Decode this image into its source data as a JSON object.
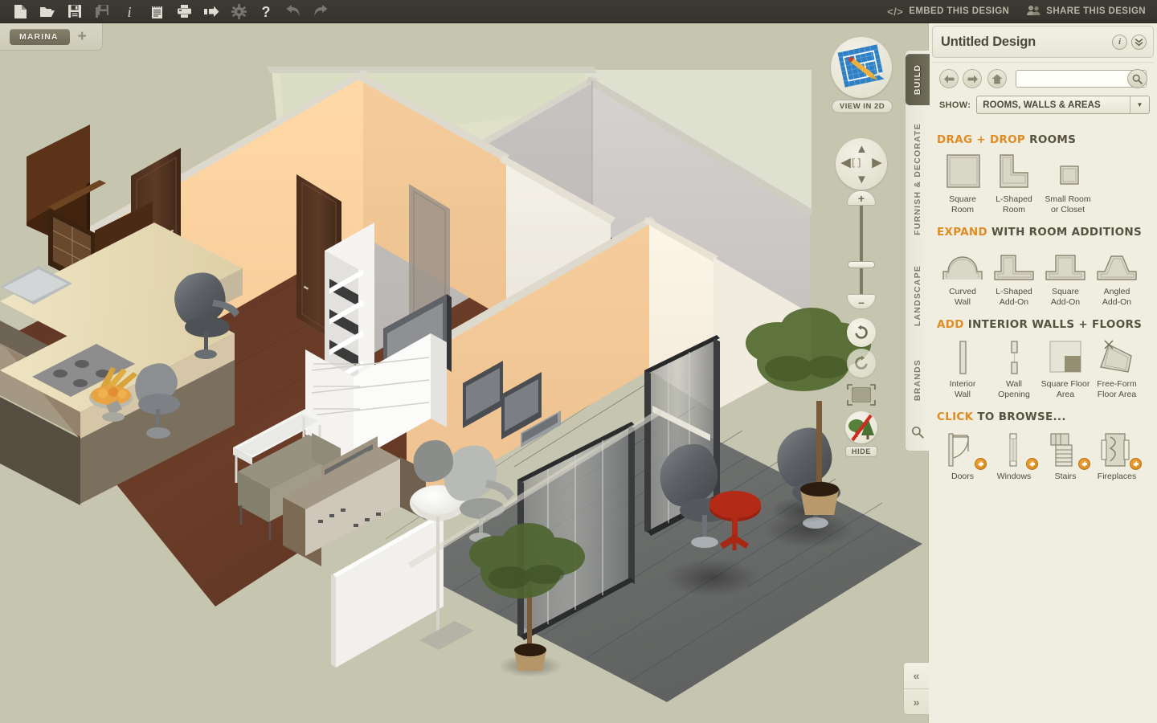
{
  "toolbar": {
    "icons": [
      {
        "name": "new-file-icon",
        "title": "New",
        "dim": false
      },
      {
        "name": "open-folder-icon",
        "title": "Open",
        "dim": false
      },
      {
        "name": "save-icon",
        "title": "Save",
        "dim": false
      },
      {
        "name": "save-as-icon",
        "title": "Save As",
        "dim": true
      },
      {
        "name": "info-icon",
        "title": "Info",
        "dim": false
      },
      {
        "name": "notepad-icon",
        "title": "Notes",
        "dim": false
      },
      {
        "name": "print-icon",
        "title": "Print",
        "dim": false
      },
      {
        "name": "export-icon",
        "title": "Export",
        "dim": false
      },
      {
        "name": "gear-icon",
        "title": "Settings",
        "dim": true
      },
      {
        "name": "help-icon",
        "title": "Help",
        "dim": false
      },
      {
        "name": "undo-icon",
        "title": "Undo",
        "dim": true
      },
      {
        "name": "redo-icon",
        "title": "Redo",
        "dim": true
      }
    ],
    "embed_label": "EMBED THIS DESIGN",
    "share_label": "SHARE THIS DESIGN",
    "embed_icon_text": "</>"
  },
  "tabbar": {
    "document_tab": "MARINA",
    "add_tab": "+"
  },
  "viewport": {
    "view_2d_label": "VIEW IN 2D",
    "hide_label": "HIDE",
    "zoom_plus": "+",
    "zoom_minus": "–",
    "pad_center": "[ ]"
  },
  "rail": {
    "tabs": [
      {
        "label": "BUILD",
        "active": true
      },
      {
        "label": "FURNISH & DECORATE",
        "active": false
      },
      {
        "label": "LANDSCAPE",
        "active": false
      },
      {
        "label": "BRANDS",
        "active": false
      }
    ],
    "search_icon": "search-icon"
  },
  "panel": {
    "title": "Untitled Design",
    "info_button": "i",
    "collapse_button": "»",
    "search_value": "",
    "search_placeholder": "",
    "show_label": "SHOW:",
    "show_value": "ROOMS, WALLS & AREAS",
    "sections": [
      {
        "title_accent": "DRAG + DROP",
        "title_rest": " ROOMS",
        "tiles": [
          {
            "label": "Square\nRoom",
            "art": "square-room"
          },
          {
            "label": "L-Shaped\nRoom",
            "art": "l-shaped-room"
          },
          {
            "label": "Small Room\nor Closet",
            "art": "small-room"
          }
        ]
      },
      {
        "title_accent": "EXPAND",
        "title_rest": " WITH ROOM ADDITIONS",
        "tiles": [
          {
            "label": "Curved\nWall",
            "art": "curved-wall"
          },
          {
            "label": "L-Shaped\nAdd-On",
            "art": "l-add-on"
          },
          {
            "label": "Square\nAdd-On",
            "art": "square-add-on"
          },
          {
            "label": "Angled\nAdd-On",
            "art": "angled-add-on"
          }
        ]
      },
      {
        "title_accent": "ADD",
        "title_rest": " INTERIOR WALLS + FLOORS",
        "tiles": [
          {
            "label": "Interior\nWall",
            "art": "interior-wall"
          },
          {
            "label": "Wall\nOpening",
            "art": "wall-opening"
          },
          {
            "label": "Square Floor\nArea",
            "art": "square-floor"
          },
          {
            "label": "Free-Form\nFloor Area",
            "art": "free-form-floor"
          }
        ]
      },
      {
        "title_accent": "CLICK",
        "title_rest": " TO BROWSE...",
        "tiles": [
          {
            "label": "Doors",
            "art": "door",
            "badge": true
          },
          {
            "label": "Windows",
            "art": "window",
            "badge": true
          },
          {
            "label": "Stairs",
            "art": "stairs",
            "badge": true
          },
          {
            "label": "Fireplaces",
            "art": "fireplace",
            "badge": true
          }
        ]
      }
    ]
  },
  "corner": {
    "collapse_left": "«",
    "expand_right": "»"
  },
  "colors": {
    "accent_orange": "#e08c24",
    "toolbar_dark": "#3d3b33",
    "panel_bg": "#f0eee1",
    "viewport_bg": "#c6c5b0",
    "active_tab": "#5d5a49"
  }
}
